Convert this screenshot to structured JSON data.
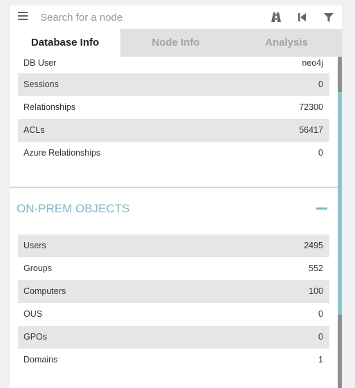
{
  "search": {
    "placeholder": "Search for a node"
  },
  "icons": {
    "menu": "hamburger-menu-icon",
    "pathfinding": "road-icon",
    "back": "skip-back-icon",
    "filter": "filter-icon"
  },
  "tabs": [
    {
      "label": "Database Info",
      "active": true
    },
    {
      "label": "Node Info",
      "active": false
    },
    {
      "label": "Analysis",
      "active": false
    }
  ],
  "database_rows": [
    {
      "label": "DB User",
      "value": "neo4j"
    },
    {
      "label": "Sessions",
      "value": "0"
    },
    {
      "label": "Relationships",
      "value": "72300"
    },
    {
      "label": "ACLs",
      "value": "56417"
    },
    {
      "label": "Azure Relationships",
      "value": "0"
    }
  ],
  "onprem": {
    "title": "ON-PREM OBJECTS",
    "rows": [
      {
        "label": "Users",
        "value": "2495"
      },
      {
        "label": "Groups",
        "value": "552"
      },
      {
        "label": "Computers",
        "value": "100"
      },
      {
        "label": "OUS",
        "value": "0"
      },
      {
        "label": "GPOs",
        "value": "0"
      },
      {
        "label": "Domains",
        "value": "1"
      }
    ]
  },
  "colors": {
    "accent": "#7eb6c6",
    "row_shade": "#e6e6e6",
    "scroll_thumb": "#8fc3d2"
  }
}
